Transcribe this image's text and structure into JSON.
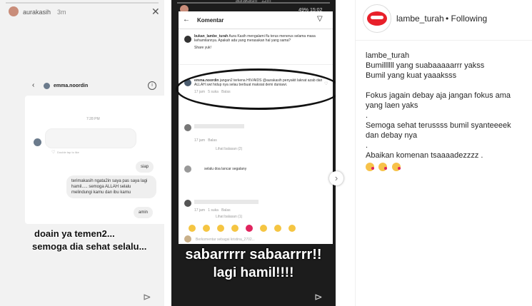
{
  "left_story": {
    "username": "aurakasih",
    "time": "3m",
    "chat": {
      "contact": "emma.noordin",
      "timestamp": "7:28 PM",
      "reaction_text": "Double tap to like",
      "messages": [
        {
          "from": "me",
          "text": "siap"
        },
        {
          "from": "me",
          "text": "terimakasih ngata2in saya pas saya lagi hamil..... semoga ALLAH selalu melindungi kamu dan ibu kamu"
        },
        {
          "from": "me",
          "text": "amin"
        }
      ]
    },
    "overlay_line1": "doain ya temen2...",
    "overlay_line2": "semoga dia sehat selalu..."
  },
  "right_story": {
    "username": "aurakasih",
    "time": "12m",
    "status_bar": "49% 15:02",
    "comments_title": "Komentar",
    "post_author": "bukan_lambe_turah",
    "post_text": "Aura Kasih mengalami flu terus menerus selama masa kehamilannya. Apakah ada yang merasakan hal yang sama?",
    "share_text": "Share yuk!",
    "circled_comment": {
      "author": "emma.noordin",
      "text": "jangan2 terkena HIV/AIDS @aurakasih penyakit laknat azab dari ALLAH swt hidup nya selau berbuat maksiat demi duniawi.",
      "time": "17 jam",
      "likes": "5 suka",
      "reply": "Balas"
    },
    "comment2_meta": {
      "time": "17 jam",
      "reply": "Balas"
    },
    "view_replies": "Lihat balasan (2)",
    "comment3_text": "selalu doa lancar segalany",
    "comment3_meta": {
      "time": "17 jam",
      "likes": "1 suka",
      "reply": "Balas"
    },
    "view_replies2": "Lihat balasan (1)",
    "comment_placeholder": "Berkomentar sebagai kristina_2702...",
    "overlay_line1": "sabarrrrr sabaarrrr!!",
    "overlay_line2": "lagi hamil!!!!"
  },
  "post": {
    "username": "lambe_turah",
    "follow_status": "• Following",
    "caption_username": "lambe_turah",
    "caption_lines": [
      "Bumillllll yang suabaaaaarrr yakss",
      "Bumil yang kuat yaaaksss",
      "",
      "Fokus jagain debay aja jangan fokus ama",
      "yang laen yaks",
      ".",
      "Semoga sehat terussss bumil syanteeeek",
      "dan debay nya",
      ".",
      "Abaikan komenan tsaaaadezzzz ."
    ],
    "emojis": [
      "face-blowing-kiss",
      "face-blowing-kiss",
      "face-blowing-kiss"
    ],
    "accent_color": "#e8202a"
  }
}
